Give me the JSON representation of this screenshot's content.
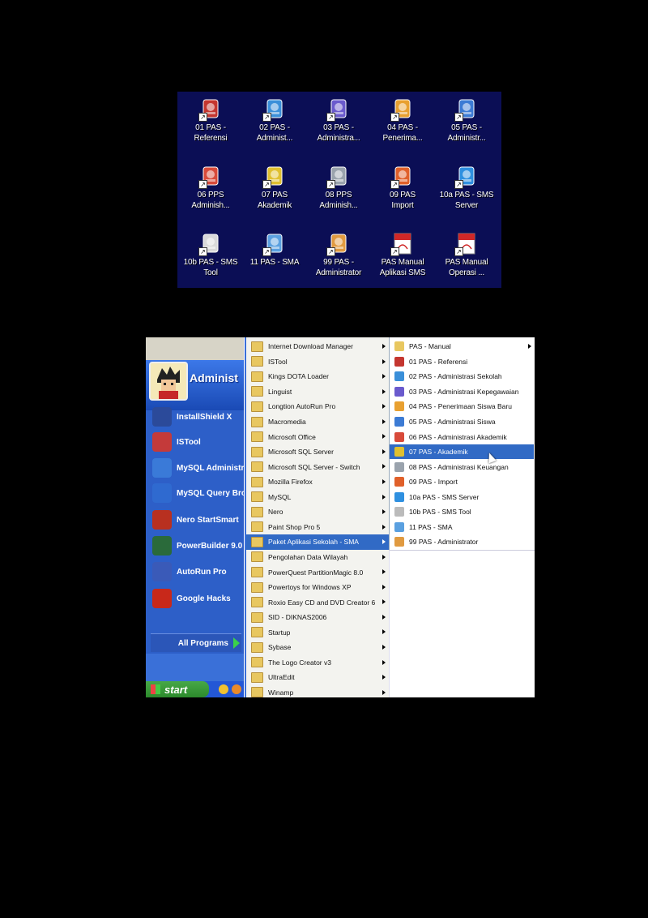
{
  "desktop": {
    "icons": [
      {
        "label": "01 PAS -\nReferensi",
        "icon": "stacked-books-icon",
        "color": "#c4362f"
      },
      {
        "label": "02 PAS -\nAdminist...",
        "icon": "pencil-document-icon",
        "color": "#3a8fd9"
      },
      {
        "label": "03 PAS -\nAdministra...",
        "icon": "user-book-icon",
        "color": "#6a5acd"
      },
      {
        "label": "04 PAS -\nPenerima...",
        "icon": "document-plus-icon",
        "color": "#e8a030"
      },
      {
        "label": "05 PAS -\nAdministr...",
        "icon": "student-icon",
        "color": "#3c7bd4"
      },
      {
        "label": "06 PPS\nAdminish...",
        "icon": "pen-edit-icon",
        "color": "#d84a3a"
      },
      {
        "label": "07 PAS\nAkademik",
        "icon": "magic-wand-icon",
        "color": "#e0c030"
      },
      {
        "label": "08 PPS\nAdminish...",
        "icon": "money-wrench-icon",
        "color": "#9aa3ad"
      },
      {
        "label": "09 PAS\nImport",
        "icon": "import-arrow-icon",
        "color": "#e0602a"
      },
      {
        "label": "10a PAS - SMS\nServer",
        "icon": "globe-icon",
        "color": "#2f90e0"
      },
      {
        "label": "10b PAS - SMS\nTool",
        "icon": "phone-icon",
        "color": "#d9d9d9"
      },
      {
        "label": "11 PAS - SMA",
        "icon": "monitor-icon",
        "color": "#5aa0e0"
      },
      {
        "label": "99 PAS -\nAdministrator",
        "icon": "admin-user-icon",
        "color": "#e09a40"
      },
      {
        "label": "PAS Manual\nAplikasi SMS",
        "icon": "pdf-icon",
        "color": "#d02828"
      },
      {
        "label": "PAS Manual\nOperasi ...",
        "icon": "pdf-icon",
        "color": "#d02828"
      }
    ]
  },
  "start_menu": {
    "user_name": "Administ",
    "pinned": [
      {
        "label": "InstallShield X",
        "icon": "installshield-icon",
        "color": "#2b4a9a"
      },
      {
        "label": "ISTool",
        "icon": "istool-icon",
        "color": "#c43a3a"
      },
      {
        "label": "MySQL Administra",
        "icon": "mysql-admin-icon",
        "color": "#3a7ad8"
      },
      {
        "label": "MySQL Query Brov",
        "icon": "mysql-query-icon",
        "color": "#2f6ad0"
      },
      {
        "label": "Nero StartSmart",
        "icon": "nero-icon",
        "color": "#b83020"
      },
      {
        "label": "PowerBuilder 9.0",
        "icon": "powerbuilder-icon",
        "color": "#2a6a3a"
      },
      {
        "label": "AutoRun Pro",
        "icon": "autorun-icon",
        "color": "#3a5ab8"
      },
      {
        "label": "Google Hacks",
        "icon": "google-hacks-icon",
        "color": "#c8281a"
      }
    ],
    "all_programs": "All Programs",
    "start_label": "start",
    "programs": [
      {
        "label": "Internet Download Manager"
      },
      {
        "label": "ISTool"
      },
      {
        "label": "Kings DOTA Loader"
      },
      {
        "label": "Linguist"
      },
      {
        "label": "Longtion AutoRun Pro"
      },
      {
        "label": "Macromedia"
      },
      {
        "label": "Microsoft Office"
      },
      {
        "label": "Microsoft SQL Server"
      },
      {
        "label": "Microsoft SQL Server - Switch"
      },
      {
        "label": "Mozilla Firefox"
      },
      {
        "label": "MySQL"
      },
      {
        "label": "Nero"
      },
      {
        "label": "Paint Shop Pro 5"
      },
      {
        "label": "Paket Aplikasi Sekolah - SMA",
        "selected": true
      },
      {
        "label": "Pengolahan Data Wilayah"
      },
      {
        "label": "PowerQuest PartitionMagic 8.0"
      },
      {
        "label": "Powertoys for Windows XP"
      },
      {
        "label": "Roxio Easy CD and DVD Creator 6"
      },
      {
        "label": "SID - DIKNAS2006"
      },
      {
        "label": "Startup"
      },
      {
        "label": "Sybase"
      },
      {
        "label": "The Logo Creator v3"
      },
      {
        "label": "UltraEdit"
      },
      {
        "label": "Winamp"
      }
    ],
    "submenu": [
      {
        "label": "PAS - Manual",
        "icon": "folder-icon",
        "color": "#e8c760",
        "has_arrow": true
      },
      {
        "label": "01 PAS - Referensi",
        "icon": "books-icon",
        "color": "#c4362f"
      },
      {
        "label": "02 PAS - Administrasi Sekolah",
        "icon": "pencil-document-icon",
        "color": "#3a8fd9"
      },
      {
        "label": "03 PAS - Administrasi Kepegawaian",
        "icon": "user-book-icon",
        "color": "#6a5acd"
      },
      {
        "label": "04 PAS - Penerimaan Siswa Baru",
        "icon": "document-plus-icon",
        "color": "#e8a030"
      },
      {
        "label": "05 PAS - Administrasi Siswa",
        "icon": "student-icon",
        "color": "#3c7bd4"
      },
      {
        "label": "06 PAS - Administrasi Akademik",
        "icon": "pen-edit-icon",
        "color": "#d84a3a"
      },
      {
        "label": "07 PAS - Akademik",
        "icon": "magic-wand-icon",
        "color": "#e0c030",
        "selected": true
      },
      {
        "label": "08 PAS - Administrasi Keuangan",
        "icon": "money-wrench-icon",
        "color": "#9aa3ad"
      },
      {
        "label": "09 PAS - Import",
        "icon": "import-arrow-icon",
        "color": "#e0602a"
      },
      {
        "label": "10a PAS - SMS Server",
        "icon": "globe-icon",
        "color": "#2f90e0"
      },
      {
        "label": "10b PAS - SMS Tool",
        "icon": "phone-icon",
        "color": "#bbbbbb"
      },
      {
        "label": "11 PAS - SMA",
        "icon": "monitor-icon",
        "color": "#5aa0e0"
      },
      {
        "label": "99 PAS - Administrator",
        "icon": "admin-user-icon",
        "color": "#e09a40"
      }
    ]
  },
  "colors": {
    "desktop_bg": "#0b0e55",
    "menu_highlight": "#316ac5",
    "xp_blue": "#2d5fc8",
    "start_green": "#3a9a3a"
  }
}
